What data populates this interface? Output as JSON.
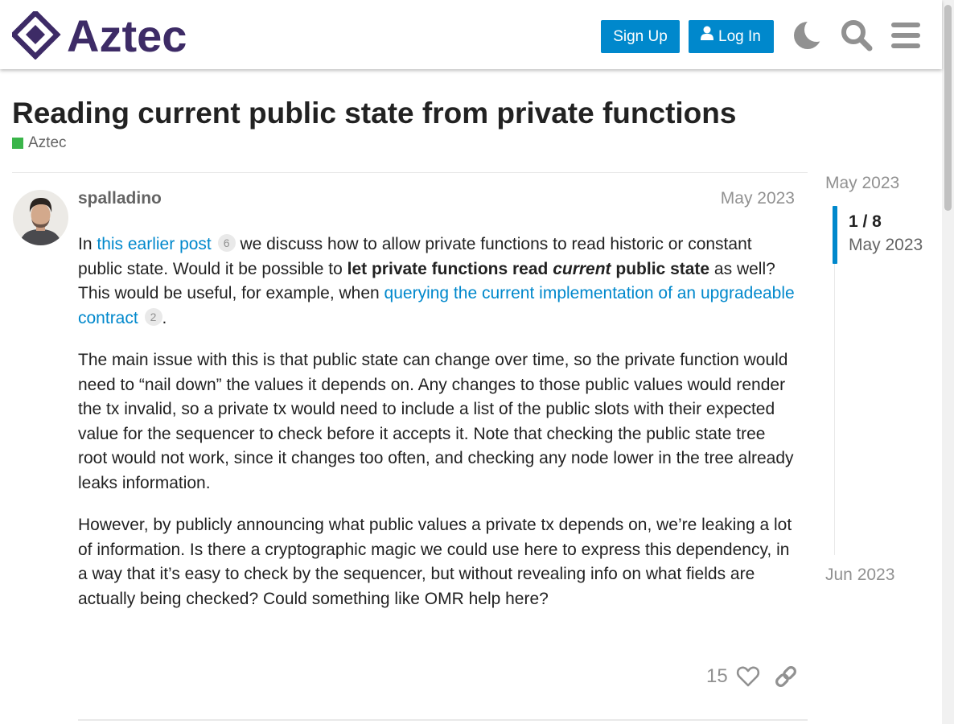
{
  "header": {
    "logo_text": "Aztec",
    "signup_label": "Sign Up",
    "login_label": "Log In",
    "icons": [
      "moon-icon",
      "search-icon",
      "hamburger-menu-icon"
    ]
  },
  "topic": {
    "title": "Reading current public state from private functions",
    "category": "Aztec",
    "category_color": "#3ab54a"
  },
  "post": {
    "username": "spalladino",
    "date": "May 2023",
    "p1": {
      "t1": "In ",
      "link1": "this earlier post",
      "link1_count": "6",
      "t2": " we discuss how to allow private functions to read historic or constant public state. Would it be possible to ",
      "b1": "let private functions read ",
      "bi": "current",
      "b2": " public state",
      "t3": " as well? This would be useful, for example, when ",
      "link2": "querying the current implementation of an upgradeable contract",
      "link2_count": "2",
      "t4": "."
    },
    "p2": "The main issue with this is that public state can change over time, so the private function would need to “nail down” the values it depends on. Any changes to those public values would render the tx invalid, so a private tx would need to include a list of the public slots with their expected value for the sequencer to check before it accepts it. Note that checking the public state tree root would not work, since it changes too often, and checking any node lower in the tree already leaks information.",
    "p3": "However, by publicly announcing what public values a private tx depends on, we’re leaking a lot of information. Is there a cryptographic magic we could use here to express this dependency, in a way that it’s easy to check by the sequencer, but without revealing info on what fields are actually being checked? Could something like OMR help here?",
    "like_count": "15",
    "actions": [
      "heart-icon",
      "link-icon"
    ]
  },
  "timeline": {
    "start": "May 2023",
    "counter": "1 / 8",
    "current_date": "May 2023",
    "end": "Jun 2023"
  },
  "colors": {
    "accent": "#0088cc",
    "brand": "#3d2b66",
    "muted": "#919191"
  }
}
